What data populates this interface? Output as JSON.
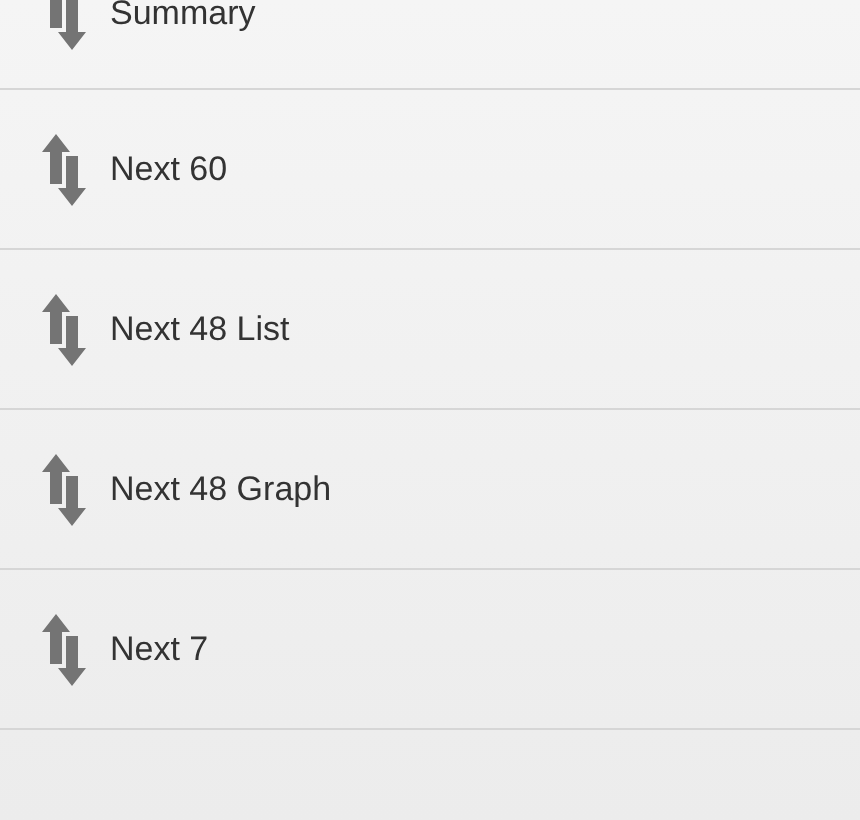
{
  "menu_items": [
    {
      "label": "Summary"
    },
    {
      "label": "Next 60"
    },
    {
      "label": "Next 48 List"
    },
    {
      "label": "Next 48 Graph"
    },
    {
      "label": "Next 7"
    }
  ]
}
